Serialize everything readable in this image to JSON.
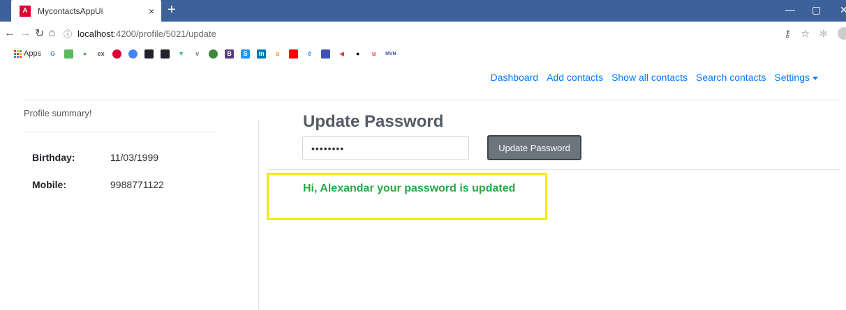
{
  "browser": {
    "tab_title": "MycontactsAppUi",
    "favicon_letter": "A",
    "close_tab": "×",
    "new_tab": "+",
    "url_host": "localhost",
    "url_path": ":4200/profile/5021/update",
    "apps_label": "Apps"
  },
  "nav": {
    "dashboard": "Dashboard",
    "add_contacts": "Add contacts",
    "show_all_contacts": "Show all contacts",
    "search_contacts": "Search contacts",
    "settings": "Settings"
  },
  "sidebar": {
    "heading": "Profile summary!",
    "rows": [
      {
        "label": "Birthday:",
        "value": "11/03/1999"
      },
      {
        "label": "Mobile:",
        "value": "9988771122"
      }
    ]
  },
  "main": {
    "title": "Update Password",
    "password_value": "••••••••",
    "button_label": "Update Password",
    "success_message": "Hi, Alexandar your password is updated"
  },
  "colors": {
    "link": "#007bff",
    "success": "#28a745",
    "button": "#6c757d",
    "highlight": "#f5ea11",
    "tabbar": "#3d629b"
  }
}
